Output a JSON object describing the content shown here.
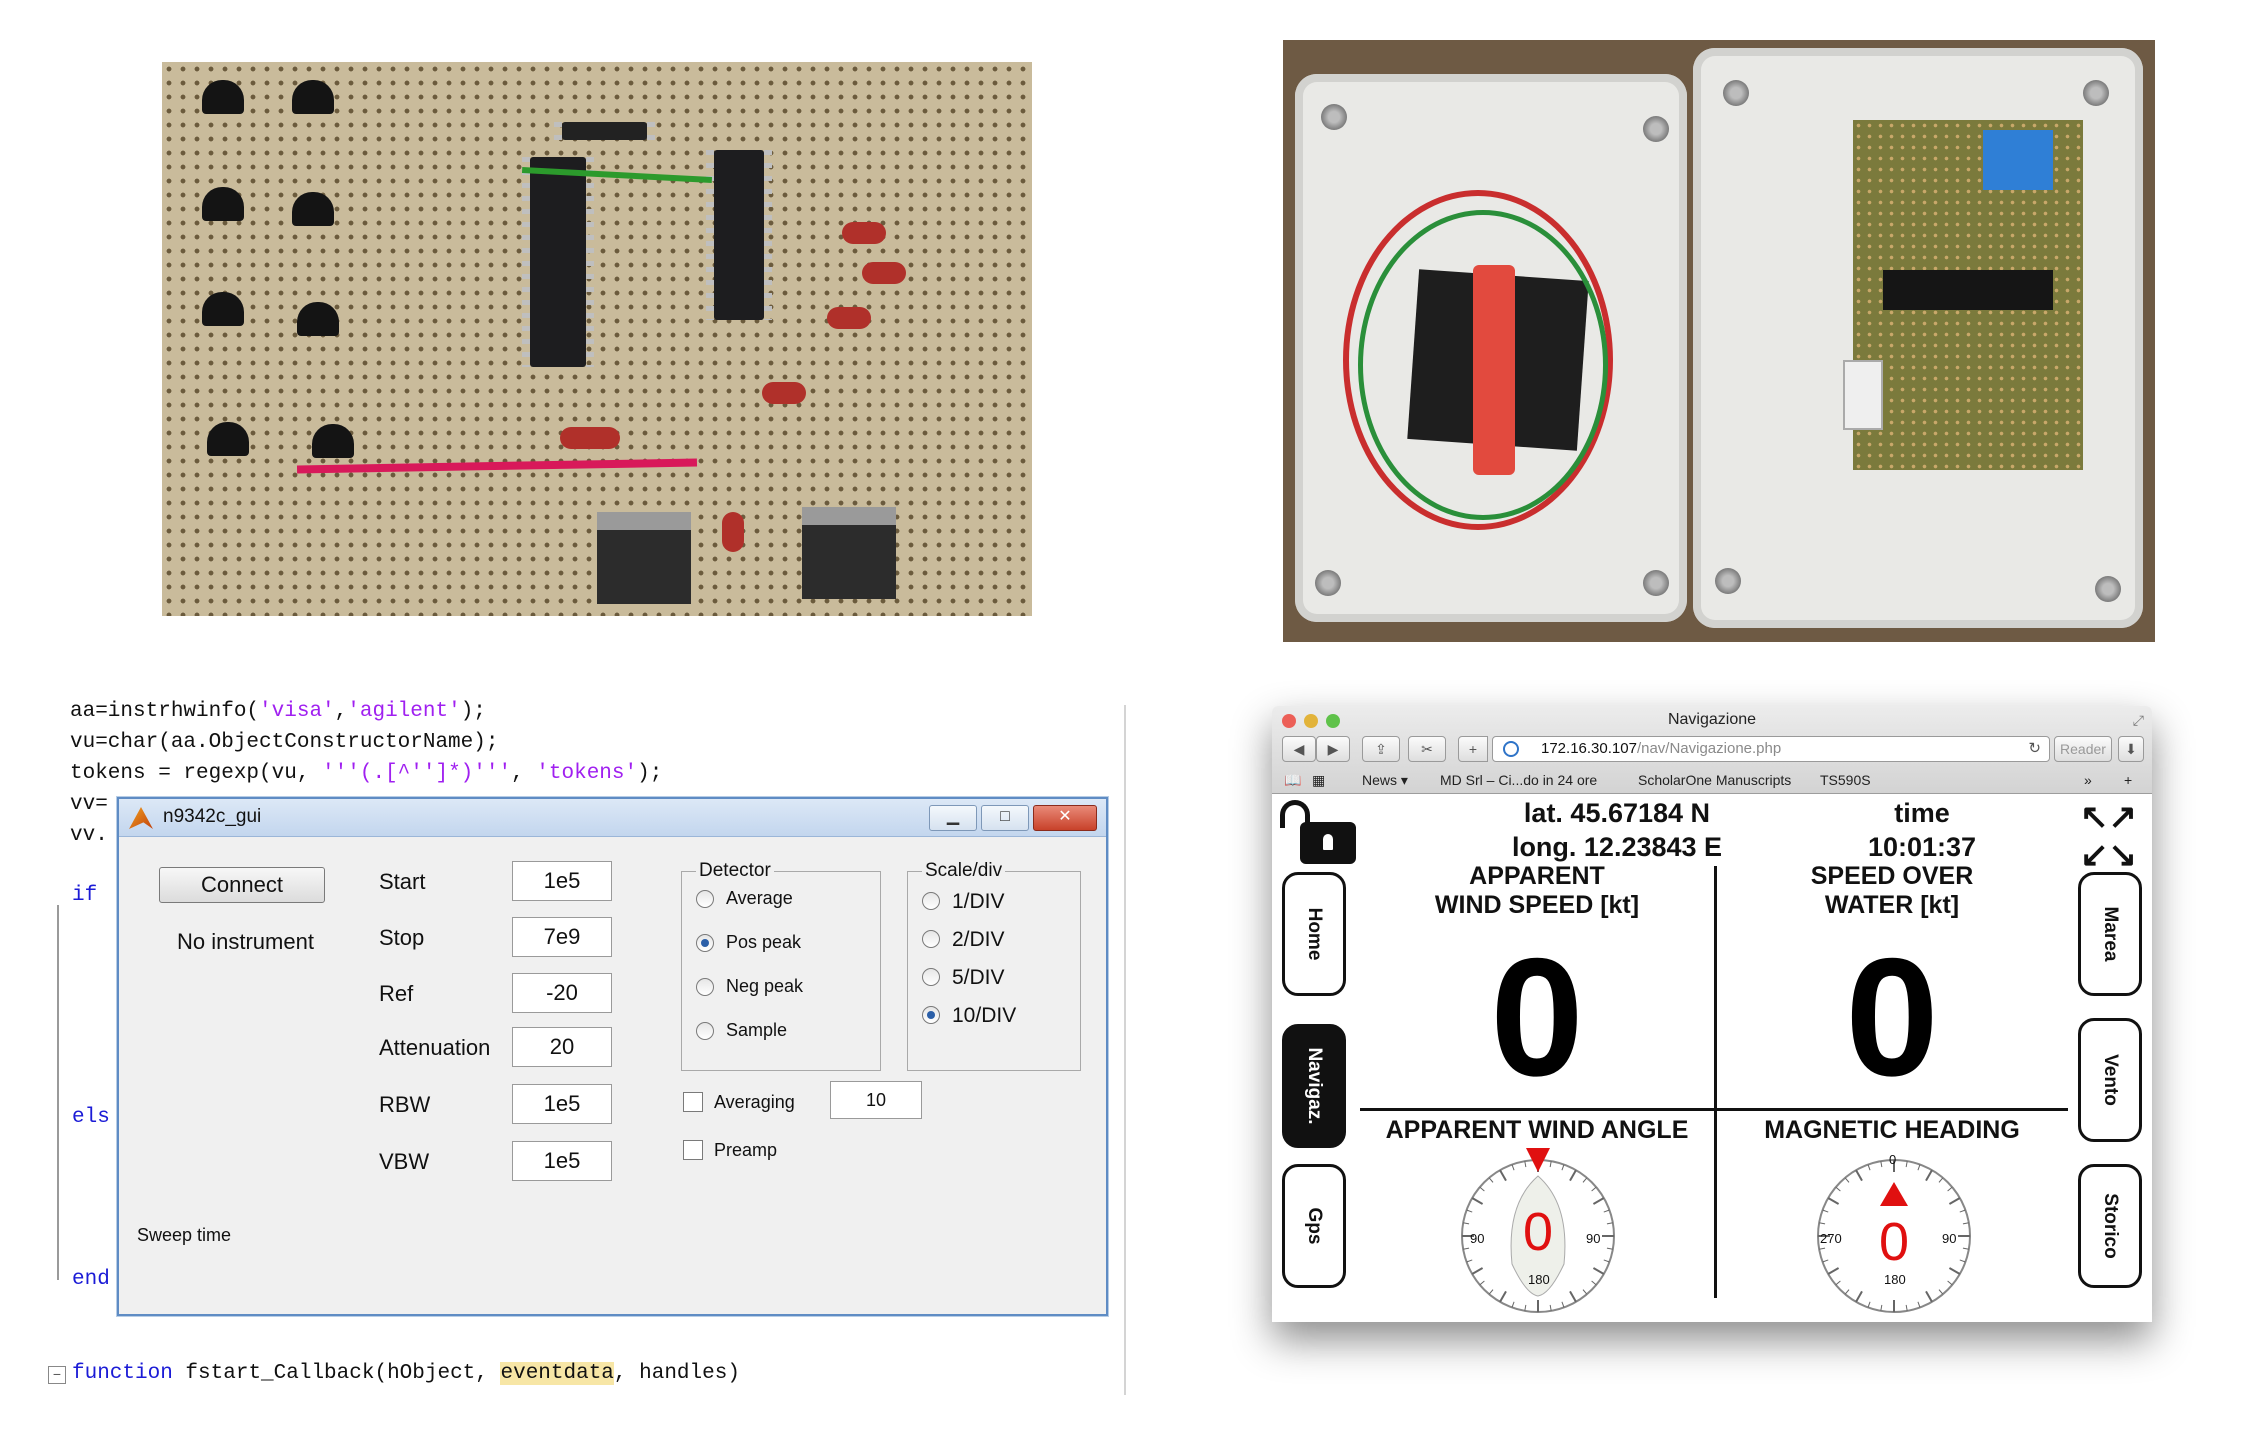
{
  "editor": {
    "code_lines": [
      {
        "parts": [
          {
            "t": "aa=instrhwinfo(",
            "c": ""
          },
          {
            "t": "'visa'",
            "c": "str"
          },
          {
            "t": ",",
            "c": ""
          },
          {
            "t": "'agilent'",
            "c": "str"
          },
          {
            "t": ");",
            "c": ""
          }
        ]
      },
      {
        "parts": [
          {
            "t": "vu=char(aa.ObjectConstructorName);",
            "c": ""
          }
        ]
      },
      {
        "parts": [
          {
            "t": "tokens = regexp(vu, ",
            "c": ""
          },
          {
            "t": "'''(.[^'']*)'''",
            "c": "str"
          },
          {
            "t": ", ",
            "c": ""
          },
          {
            "t": "'tokens'",
            "c": "str"
          },
          {
            "t": ");",
            "c": ""
          }
        ]
      },
      {
        "parts": [
          {
            "t": "vv=",
            "c": ""
          }
        ]
      },
      {
        "parts": [
          {
            "t": "vv.",
            "c": ""
          }
        ]
      },
      {
        "parts": [
          {
            "t": "if",
            "c": "kw"
          }
        ]
      },
      {
        "parts": [
          {
            "t": "els",
            "c": "kw"
          }
        ]
      },
      {
        "parts": [
          {
            "t": "end",
            "c": "kw"
          }
        ]
      },
      {
        "parts": [
          {
            "t": "function",
            "c": "kw"
          },
          {
            "t": " fstart_Callback(hObject, ",
            "c": ""
          },
          {
            "t": "eventdata",
            "c": "hl"
          },
          {
            "t": ", handles)",
            "c": ""
          }
        ]
      }
    ]
  },
  "gui": {
    "title": "n9342c_gui",
    "connect_label": "Connect",
    "status": "No instrument",
    "sweep_time_label": "Sweep time",
    "params": [
      {
        "label": "Start",
        "value": "1e5"
      },
      {
        "label": "Stop",
        "value": "7e9"
      },
      {
        "label": "Ref",
        "value": "-20"
      },
      {
        "label": "Attenuation",
        "value": "20"
      },
      {
        "label": "RBW",
        "value": "1e5"
      },
      {
        "label": "VBW",
        "value": "1e5"
      }
    ],
    "detector": {
      "title": "Detector",
      "options": [
        "Average",
        "Pos peak",
        "Neg peak",
        "Sample"
      ],
      "selected": "Pos peak"
    },
    "scale": {
      "title": "Scale/div",
      "options": [
        "1/DIV",
        "2/DIV",
        "5/DIV",
        "10/DIV"
      ],
      "selected": "10/DIV"
    },
    "averaging_label": "Averaging",
    "averaging_value": "10",
    "averaging_checked": false,
    "preamp_label": "Preamp",
    "preamp_checked": false
  },
  "browser": {
    "title": "Navigazione",
    "url_host": "172.16.30.107",
    "url_path": "/nav/Navigazione.php",
    "reader_label": "Reader",
    "bookmarks": [
      "News ▾",
      "MD Srl – Ci...do in 24 ore",
      "ScholarOne Manuscripts",
      "TS590S"
    ]
  },
  "nav": {
    "lat": "lat. 45.67184 N",
    "long": "long. 12.23843 E",
    "time_label": "time",
    "time_value": "10:01:37",
    "apparent_wind_speed": {
      "label": "APPARENT\nWIND SPEED [kt]",
      "value": "0"
    },
    "speed_over_water": {
      "label": "SPEED OVER\nWATER [kt]",
      "value": "0"
    },
    "apparent_wind_angle": {
      "label": "APPARENT WIND ANGLE",
      "value": "0",
      "ticks": [
        "90",
        "90",
        "180"
      ]
    },
    "magnetic_heading": {
      "label": "MAGNETIC HEADING",
      "value": "0",
      "ticks": [
        "0",
        "270",
        "90",
        "180"
      ]
    },
    "left_tabs": [
      "Home",
      "Navigaz.",
      "Gps"
    ],
    "right_tabs": [
      "Marea",
      "Vento",
      "Storico"
    ],
    "active_tab": "Navigaz."
  },
  "colors": {
    "accent_red": "#e01010",
    "matlab_keyword": "#1b1bd6",
    "matlab_string": "#a020f0"
  }
}
